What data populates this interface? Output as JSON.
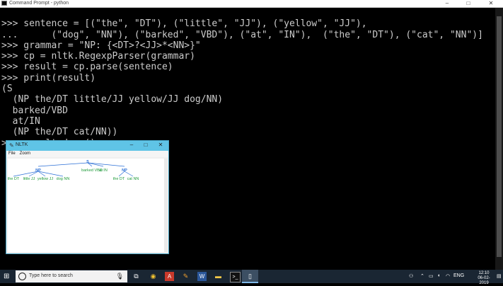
{
  "cmd_window": {
    "title": "Command Prompt - python",
    "min_icon": "–",
    "max_icon": "□",
    "close_icon": "✕"
  },
  "console_lines": [
    ">>> sentence = [(\"the\", \"DT\"), (\"little\", \"JJ\"), (\"yellow\", \"JJ\"),",
    "...      (\"dog\", \"NN\"), (\"barked\", \"VBD\"), (\"at\", \"IN\"),  (\"the\", \"DT\"), (\"cat\", \"NN\")]",
    ">>> grammar = \"NP: {<DT>?<JJ>*<NN>}\"",
    ">>> cp = nltk.RegexpParser(grammar)",
    ">>> result = cp.parse(sentence)",
    ">>> print(result)",
    "(S",
    "  (NP the/DT little/JJ yellow/JJ dog/NN)",
    "  barked/VBD",
    "  at/IN",
    "  (NP the/DT cat/NN))",
    ">>> result.draw()"
  ],
  "nltk_window": {
    "title": "NLTK",
    "menu": [
      "File",
      "Zoom"
    ],
    "min_icon": "–",
    "max_icon": "□",
    "close_icon": "✕",
    "tree": {
      "root": "S",
      "np1_label": "NP",
      "np2_label": "NP",
      "leaves_np1": [
        "the DT",
        "little JJ",
        "yellow JJ",
        "dog NN"
      ],
      "mid_leaves": [
        "barked VBD",
        "at IN"
      ],
      "leaves_np2": [
        "the DT",
        "cat NN"
      ],
      "node_color": "#2b6fd6",
      "leaf_color": "#1f9a3a"
    }
  },
  "taskbar": {
    "search_placeholder": "Type here to search",
    "tray_lang": "ENG",
    "time": "12:10",
    "date": "06-02-2019"
  }
}
